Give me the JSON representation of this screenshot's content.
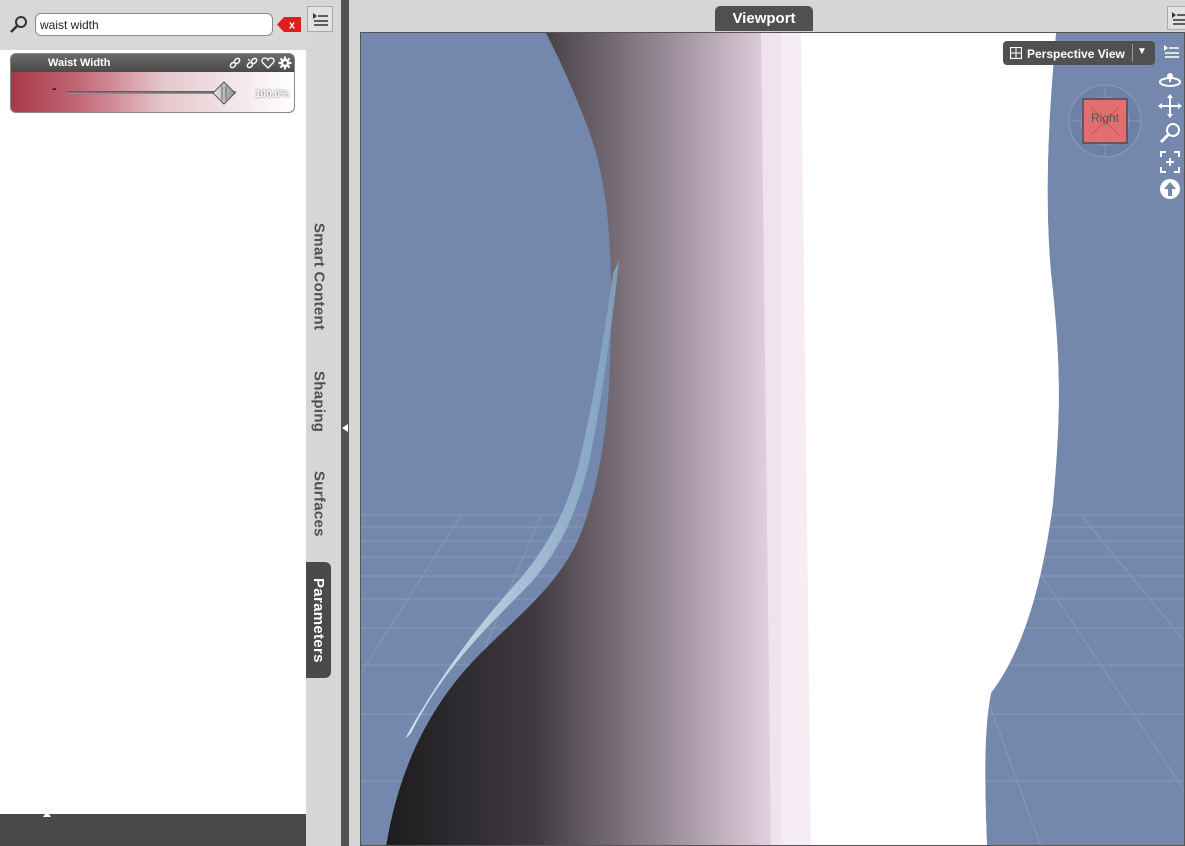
{
  "left_panel": {
    "search": {
      "value": "waist width",
      "clear_label": "x"
    },
    "parameter": {
      "label": "Waist Width",
      "minus_label": "-",
      "value": "100.0%",
      "level_fraction": 1.0
    }
  },
  "tabs": [
    "Smart Content",
    "Shaping",
    "Surfaces",
    "Parameters"
  ],
  "viewport": {
    "tab_label": "Viewport",
    "view_mode": "Perspective View",
    "cube_face": "Right",
    "tools": [
      "orbit-icon",
      "pan-icon",
      "zoom-icon",
      "frame-icon",
      "home-icon"
    ]
  },
  "colors": {
    "accent_param": "#a8384a",
    "viewport_bg": "#7487ad",
    "panel_dark": "#4a4a4a"
  }
}
